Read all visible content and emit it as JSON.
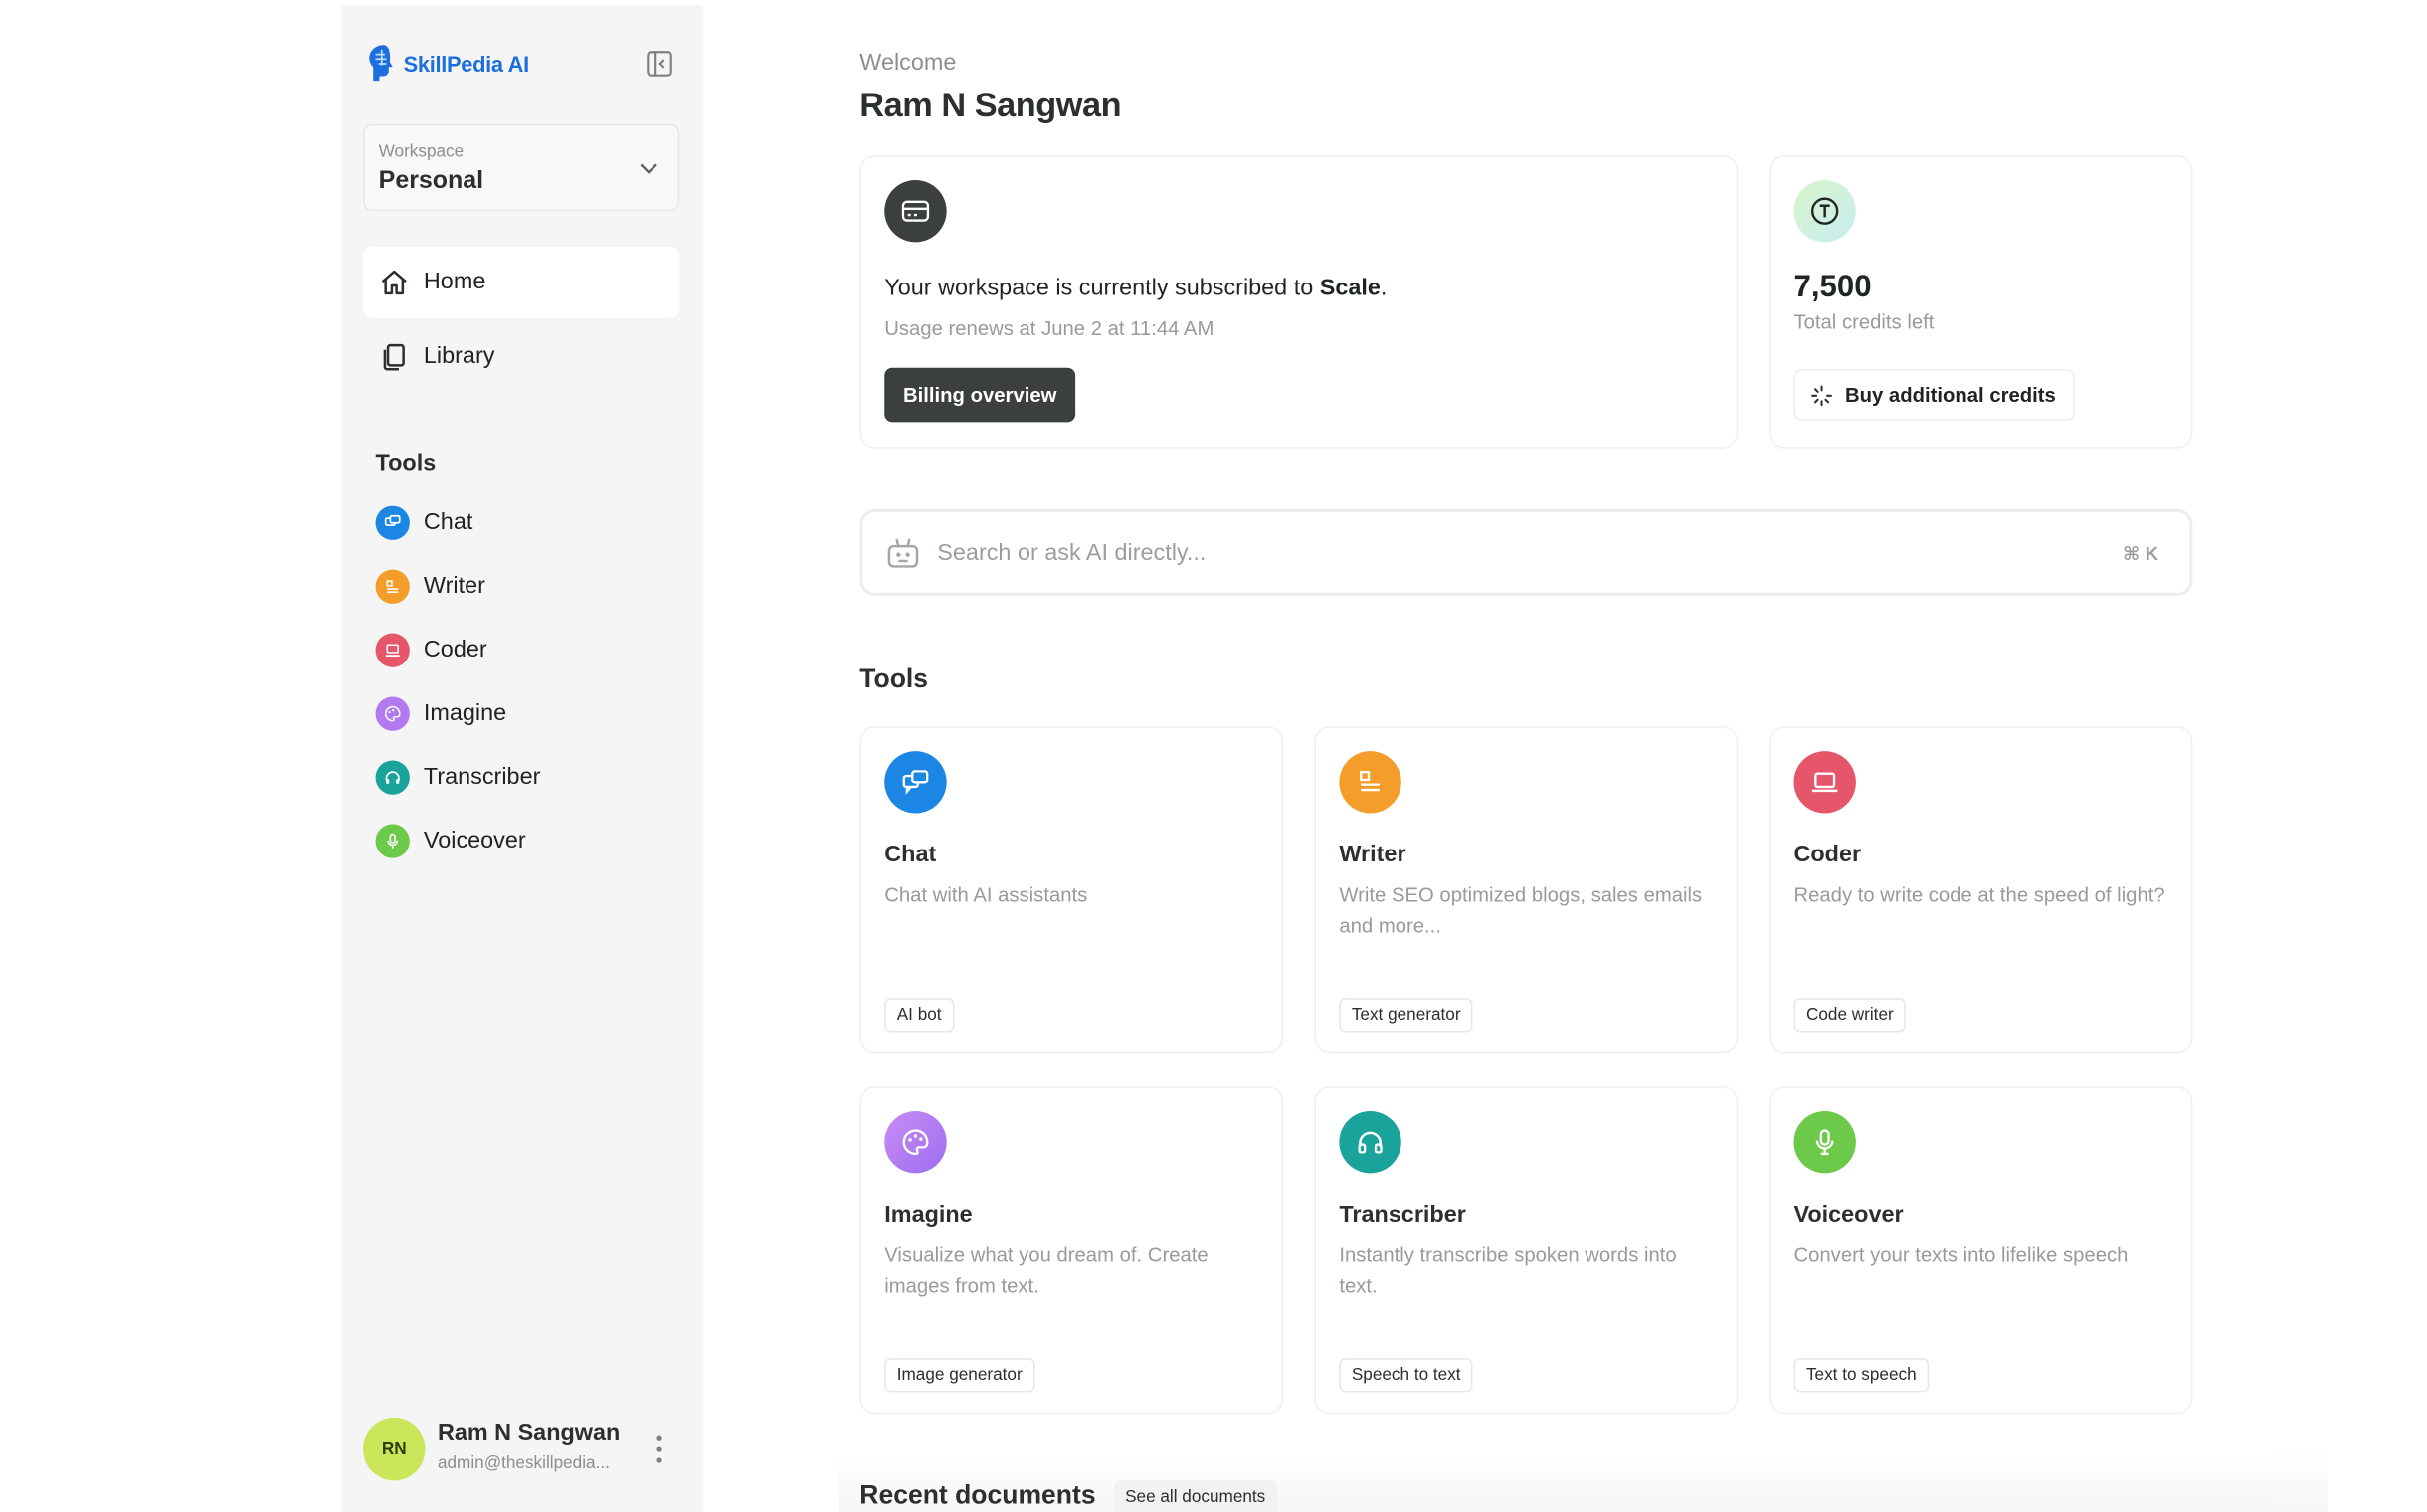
{
  "brand": {
    "name": "SkillPedia AI",
    "color": "#1d6fe0"
  },
  "workspace": {
    "label": "Workspace",
    "value": "Personal"
  },
  "nav": {
    "home": "Home",
    "library": "Library"
  },
  "sidebar_tools": {
    "heading": "Tools",
    "items": [
      {
        "label": "Chat",
        "color": "#1b86e3"
      },
      {
        "label": "Writer",
        "color": "#f59d2a"
      },
      {
        "label": "Coder",
        "color": "#e5566a"
      },
      {
        "label": "Imagine",
        "color": "#b37af0"
      },
      {
        "label": "Transcriber",
        "color": "#1aa39a"
      },
      {
        "label": "Voiceover",
        "color": "#6cc94a"
      }
    ]
  },
  "user": {
    "initials": "RN",
    "name": "Ram N Sangwan",
    "email": "admin@theskillpedia..."
  },
  "header": {
    "welcome": "Welcome",
    "name": "Ram N Sangwan"
  },
  "subscription": {
    "text_prefix": "Your workspace is currently subscribed to ",
    "plan": "Scale",
    "text_suffix": ".",
    "renew": "Usage renews at June 2 at 11:44 AM",
    "button": "Billing overview"
  },
  "credits": {
    "amount": "7,500",
    "label": "Total credits left",
    "button": "Buy additional credits"
  },
  "search": {
    "placeholder": "Search or ask AI directly...",
    "shortcut": "⌘ K"
  },
  "tools": {
    "heading": "Tools",
    "cards": [
      {
        "name": "Chat",
        "desc": "Chat with AI assistants",
        "tag": "AI bot",
        "color": "#1b86e3"
      },
      {
        "name": "Writer",
        "desc": "Write SEO optimized blogs, sales emails and more...",
        "tag": "Text generator",
        "color": "#f59d2a"
      },
      {
        "name": "Coder",
        "desc": "Ready to write code at the speed of light?",
        "tag": "Code writer",
        "color": "#e5566a"
      },
      {
        "name": "Imagine",
        "desc": "Visualize what you dream of. Create images from text.",
        "tag": "Image generator",
        "color": "#b37af0"
      },
      {
        "name": "Transcriber",
        "desc": "Instantly transcribe spoken words into text.",
        "tag": "Speech to text",
        "color": "#1aa39a"
      },
      {
        "name": "Voiceover",
        "desc": "Convert your texts into lifelike speech",
        "tag": "Text to speech",
        "color": "#6cc94a"
      }
    ]
  },
  "recent": {
    "title": "Recent documents",
    "see_all": "See all documents"
  }
}
